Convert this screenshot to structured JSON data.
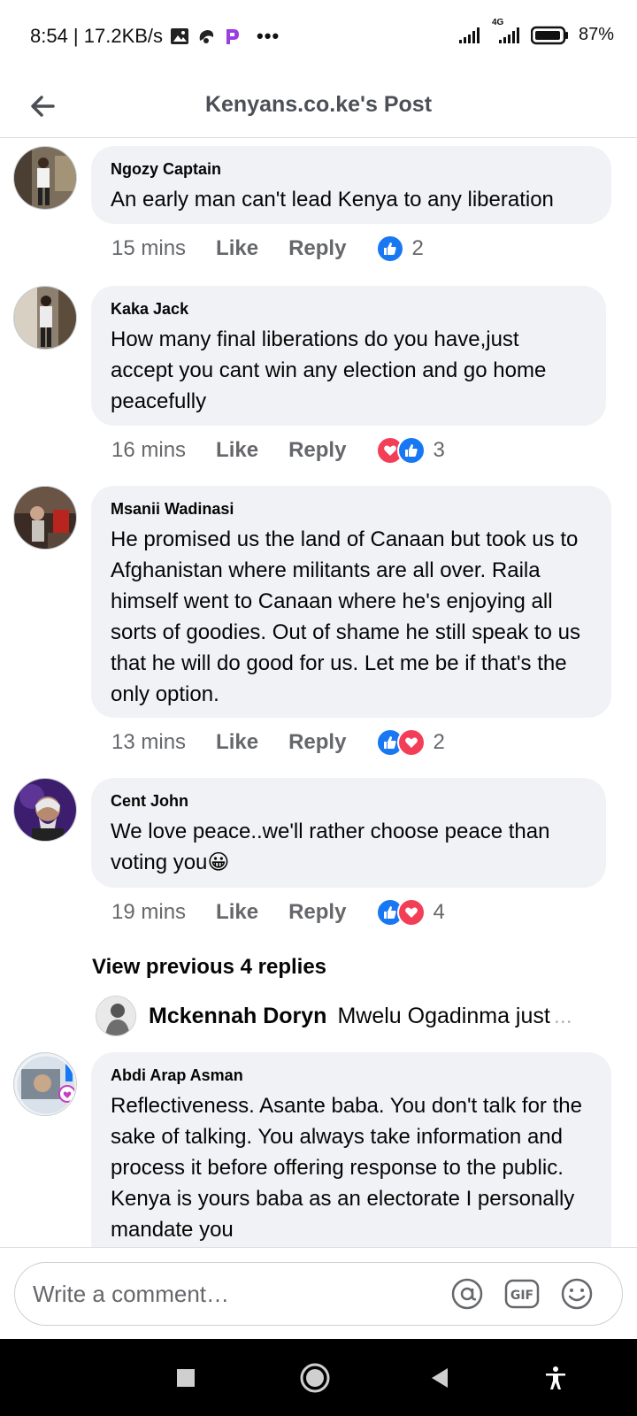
{
  "status_bar": {
    "time_speed": "8:54 | 17.2KB/s",
    "more": "•••",
    "network_label": "4G",
    "battery": "87%"
  },
  "header": {
    "title": "Kenyans.co.ke's Post"
  },
  "comments": [
    {
      "name": "Ngozy Captain",
      "text": "An early man can't lead Kenya to any liberation",
      "time": "15 mins",
      "like": "Like",
      "reply": "Reply",
      "reactions": [
        "like"
      ],
      "count": "2"
    },
    {
      "name": "Kaka Jack",
      "text": "How many final liberations do you have,just accept you cant win any election and go home peacefully",
      "time": "16 mins",
      "like": "Like",
      "reply": "Reply",
      "reactions": [
        "love",
        "like"
      ],
      "count": "3"
    },
    {
      "name": "Msanii Wadinasi",
      "text": "He promised us the land of Canaan but took us to Afghanistan where militants are all over. Raila himself went to Canaan where he's enjoying all sorts of goodies. Out of shame he still speak to us that he will do good for us. Let me be if that's the only option.",
      "time": "13 mins",
      "like": "Like",
      "reply": "Reply",
      "reactions": [
        "like",
        "love"
      ],
      "count": "2"
    },
    {
      "name": "Cent John",
      "text": "We love peace..we'll rather choose peace than voting you😀",
      "time": "19 mins",
      "like": "Like",
      "reply": "Reply",
      "reactions": [
        "like",
        "love"
      ],
      "count": "4"
    },
    {
      "name": "Abdi Arap Asman",
      "text": "Reflectiveness. Asante baba. You don't talk for the sake of talking. You always take information and process it before offering response to the public. Kenya is yours baba as an electorate I personally mandate you"
    }
  ],
  "view_previous": "View previous 4 replies",
  "reply_preview": {
    "name": "Mckennah Doryn",
    "text": "Mwelu Ogadinma just",
    "ellipsis": "..."
  },
  "composer": {
    "placeholder": "Write a comment…"
  },
  "colors": {
    "like_blue": "#1877f2",
    "love_red": "#f33e58",
    "bubble_bg": "#f0f2f5",
    "meta_gray": "#65676b"
  }
}
